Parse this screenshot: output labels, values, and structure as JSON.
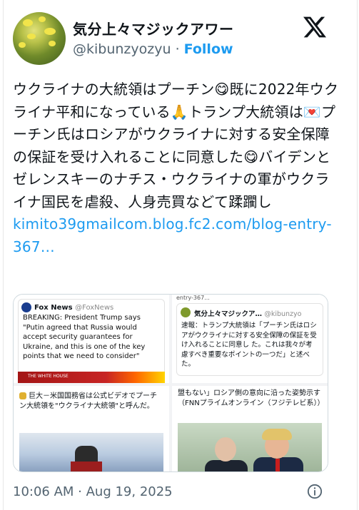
{
  "header": {
    "display_name": "気分上々マジックアワー",
    "handle": "@kibunzyozyu",
    "separator": " · ",
    "follow_label": "Follow"
  },
  "post": {
    "text_part1": "ウクライナの大統領はプーチン😋既に2022年ウクライナ平和になっている🙏トランプ大統領は💌プーチン氏はロシアがウクライナに対する安全保障の保証を受け入れることに同意した😋バイデンとゼレンスキーのナチス・ウクライナの軍がウクライナ国民を虐殺、人身売買などて蹂躙し",
    "link_text": "kimito39gmailcom.blog.fc2.com/blog-entry-367…"
  },
  "media": {
    "tile1": {
      "source_name": "Fox News",
      "source_handle": "@FoxNews",
      "text": "BREAKING: President Trump says \"Putin agreed that Russia would accept security guarantees for Ukraine, and this is one of the key points that we need to consider\"",
      "banner": "THE WHITE HOUSE"
    },
    "tile2": {
      "top_cut": "entry-367...",
      "name": "気分上々マジックア…",
      "handle": "@kibunzyo",
      "text": "速報：トランプ大統領は「プーチン氏はロシアがウクライナに対する安全保障の保証を受け入れることに同意し た。これは我々が考慮すべき重要なポイントの一つだ」と述べた。"
    },
    "tile3": {
      "text": "巨大－米国国務省は公式ビデオでプーチン大統領を\"ウクライナ大統領\"と呼んだ。"
    },
    "tile4": {
      "text": "盟もない」ロシア側の意向に沿った姿勢示す（FNNプライムオンライン（フジテレビ系））"
    }
  },
  "footer": {
    "timestamp": "10:06 AM · Aug 19, 2025"
  },
  "icons": {
    "brand": "x-logo",
    "info": "info-icon"
  },
  "colors": {
    "accent": "#1d9bf0",
    "secondary_text": "#536471"
  }
}
